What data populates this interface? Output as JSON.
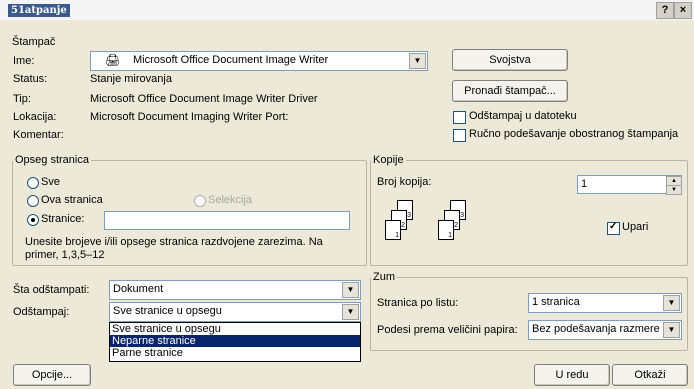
{
  "window": {
    "title": "51atpanje",
    "help_label": "?",
    "close_label": "×"
  },
  "printer": {
    "group_label": "Štampač",
    "name_label": "Ime:",
    "name_value": "Microsoft Office Document Image Writer",
    "status_label": "Status:",
    "status_value": "Stanje mirovanja",
    "type_label": "Tip:",
    "type_value": "Microsoft Office Document Image Writer Driver",
    "location_label": "Lokacija:",
    "location_value": "Microsoft Document Imaging Writer Port:",
    "comment_label": "Komentar:",
    "properties_button": "Svojstva",
    "find_printer_button": "Pronađi štampač...",
    "print_to_file_label": "Odštampaj u datoteku",
    "manual_duplex_label": "Ručno podešavanje obostranog štampanja"
  },
  "page_range": {
    "group_label": "Opseg stranica",
    "all_label": "Sve",
    "current_label": "Ova stranica",
    "selection_label": "Selekcija",
    "pages_label": "Stranice:",
    "pages_value": "",
    "hint": "Unesite brojeve i/ili opsege stranica razdvojene zarezima. Na primer, 1,3,5–12"
  },
  "copies": {
    "group_label": "Kopije",
    "count_label": "Broj kopija:",
    "count_value": "1",
    "collate_label": "Upari",
    "page_numbers": [
      "1",
      "2",
      "3"
    ]
  },
  "print_what": {
    "label": "Šta odštampati:",
    "value": "Dokument"
  },
  "print": {
    "label": "Odštampaj:",
    "value": "Sve stranice u opsegu",
    "options": [
      "Sve stranice u opsegu",
      "Neparne stranice",
      "Parne stranice"
    ]
  },
  "zoom": {
    "group_label": "Zum",
    "pages_per_sheet_label": "Stranica po listu:",
    "pages_per_sheet_value": "1 stranica",
    "scale_label": "Podesi prema veličini papira:",
    "scale_value": "Bez podešavanja razmere"
  },
  "footer": {
    "options_button": "Opcije...",
    "ok_button": "U redu",
    "cancel_button": "Otkaži"
  }
}
